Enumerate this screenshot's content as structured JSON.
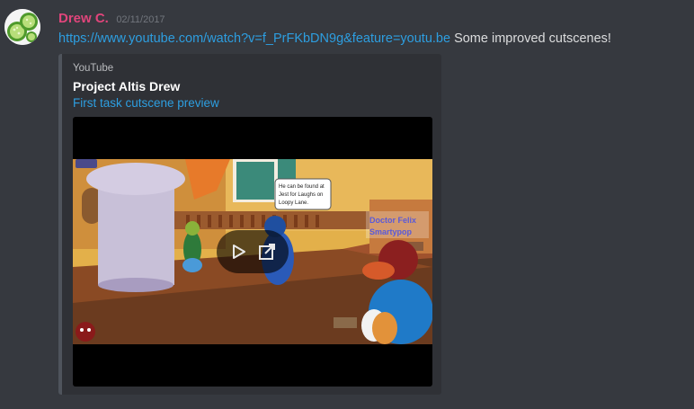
{
  "message": {
    "username": "Drew C.",
    "timestamp": "02/11/2017",
    "link_text": "https://www.youtube.com/watch?v=f_PrFKbDN9g&feature=youtu.be",
    "text": " Some improved cutscenes!"
  },
  "embed": {
    "provider": "YouTube",
    "title": "Project Altis Drew",
    "description": "First task cutscene preview",
    "video": {
      "speech_bubble": [
        "He can be found at",
        "Jest for Laughs on",
        "Loopy Lane."
      ],
      "npc_name_line1": "Doctor Felix",
      "npc_name_line2": "Smartypop"
    }
  },
  "icons": [
    "cucumber-avatar",
    "play-icon",
    "external-link-icon"
  ],
  "colors": {
    "background": "#36393f",
    "username": "#e0457b",
    "link": "#2d9ee0",
    "embed_bg": "#2f3136",
    "embed_border": "#4f545c"
  }
}
